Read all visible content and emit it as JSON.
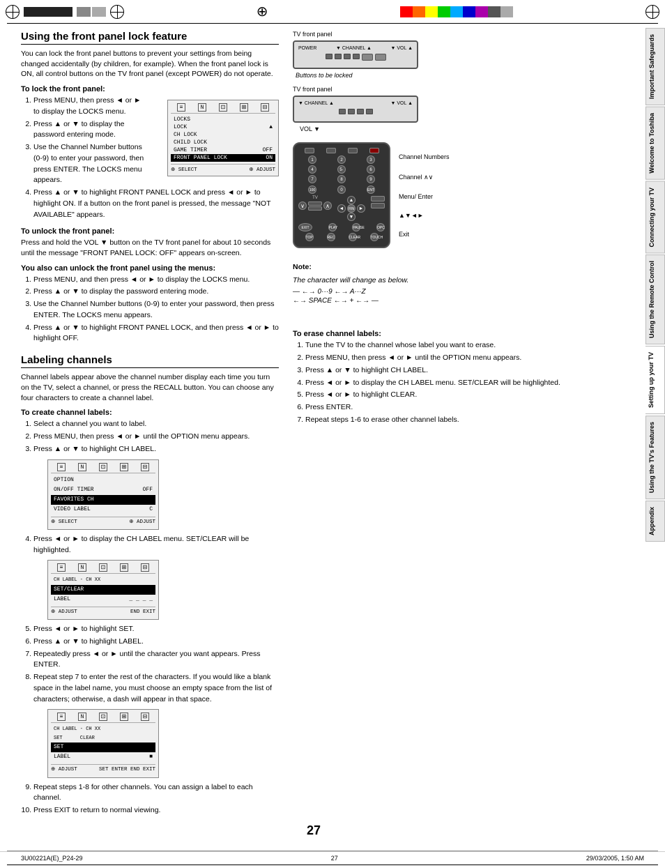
{
  "page": {
    "number": "27",
    "bottom_left": "3U00221A(E)_P24-29",
    "bottom_center": "27",
    "bottom_right": "29/03/2005, 1:50 AM"
  },
  "tabs": [
    {
      "id": "important-safeguards",
      "label": "Important Safeguards",
      "active": false
    },
    {
      "id": "welcome-toshiba",
      "label": "Welcome to Toshiba",
      "active": false
    },
    {
      "id": "connecting-tv",
      "label": "Connecting your TV",
      "active": false
    },
    {
      "id": "remote-control",
      "label": "Using the Remote Control",
      "active": false
    },
    {
      "id": "setting-up",
      "label": "Setting up your TV",
      "active": true
    },
    {
      "id": "tv-features",
      "label": "Using the TV's Features",
      "active": false
    },
    {
      "id": "appendix",
      "label": "Appendix",
      "active": false
    }
  ],
  "section1": {
    "title": "Using the front panel lock feature",
    "intro": "You can lock the front panel buttons to prevent your settings from being changed accidentally (by children, for example). When the front panel lock is ON, all control buttons on the TV front panel (except POWER) do not operate.",
    "lock_heading": "To lock the front panel:",
    "lock_steps": [
      "Press MENU, then press ◄ or ► to display the LOCKS menu.",
      "Press ▲ or ▼ to display the password entering mode.",
      "Use the Channel Number buttons (0-9) to enter your password, then press ENTER. The LOCKS menu appears.",
      "Press ▲ or ▼ to highlight FRONT PANEL LOCK and press ◄ or ► to highlight ON. If a button on the front panel is pressed, the message \"NOT AVAILABLE\" appears."
    ],
    "unlock_heading": "To unlock the front panel:",
    "unlock_text": "Press and hold the VOL ▼ button on the TV front panel for about 10 seconds until the message \"FRONT PANEL LOCK: OFF\" appears on-screen.",
    "menus_heading": "You also can unlock the front panel using the menus:",
    "menus_steps": [
      "Press MENU, and then press ◄ or ► to display the LOCKS menu.",
      "Press ▲ or ▼ to display the password entering mode.",
      "Use the Channel Number buttons (0-9) to enter your password, then press ENTER. The LOCKS menu appears.",
      "Press ▲ or ▼ to highlight FRONT PANEL LOCK, and then press ◄ or ► to highlight OFF."
    ]
  },
  "locks_menu": {
    "icons": [
      "≡",
      "N",
      "⊡",
      "⊞"
    ],
    "title": "LOCKS",
    "rows": [
      {
        "label": "LOCK",
        "value": ""
      },
      {
        "label": "CH LOCK",
        "value": ""
      },
      {
        "label": "CHILD LOCK",
        "value": ""
      },
      {
        "label": "GAME TIMER",
        "value": "OFF"
      },
      {
        "label": "FRONT PANEL LOCK",
        "value": "ON",
        "highlighted": true
      }
    ],
    "footer_left": "⊕ SELECT",
    "footer_right": "⊕ ADJUST"
  },
  "section2": {
    "title": "Labeling channels",
    "intro": "Channel labels appear above the channel number display each time you turn on the TV, select a channel, or press the RECALL button. You can choose any four characters to create a channel label.",
    "create_heading": "To create channel labels:",
    "create_steps": [
      "Select a channel you want to label.",
      "Press MENU, then press ◄ or ► until the OPTION menu appears.",
      "Press ▲ or ▼ to highlight CH LABEL.",
      "Press ◄ or ► to display the CH LABEL menu. SET/CLEAR will be highlighted.",
      "Press ◄ or ► to highlight SET.",
      "Press ▲ or ▼ to highlight LABEL.",
      "Repeatedly press ◄ or ► until the character you want appears. Press ENTER.",
      "Repeat step 7 to enter the rest of the characters. If you would like a blank space in the label name, you must choose an empty space from the list of characters; otherwise, a dash will appear in that space.",
      "Repeat steps 1-8 for other channels. You can assign a label to each channel.",
      "Press EXIT to return to normal viewing."
    ],
    "option_menu": {
      "icons": [
        "≡",
        "N",
        "⊡",
        "⊞"
      ],
      "title": "OPTION",
      "rows": [
        {
          "label": "ON/OFF TIMER",
          "value": "OFF"
        },
        {
          "label": "FAVORITES CH",
          "value": ""
        },
        {
          "label": "VIDEO LABEL",
          "value": "C"
        }
      ],
      "footer_left": "⊕ SELECT",
      "footer_right": "⊕ ADJUST"
    },
    "ch_label_menu1": {
      "icons": [
        "≡",
        "N",
        "⊡",
        "⊞"
      ],
      "title": "CH LABEL - CH XX",
      "rows": [
        {
          "label": "SET/CLEAR",
          "value": "",
          "highlighted": true
        },
        {
          "label": "LABEL",
          "value": "____"
        }
      ],
      "footer_left": "⊕ ADJUST",
      "footer_right": "END EXIT"
    },
    "ch_label_menu2": {
      "icons": [
        "≡",
        "N",
        "⊡",
        "⊞"
      ],
      "title": "CH LABEL - CH XX",
      "rows": [
        {
          "label": "SET",
          "value": "",
          "highlighted": true
        },
        {
          "label": "LABEL",
          "value": "■"
        }
      ],
      "footer_left": "⊕ ADJUST",
      "footer_right": "SET ENTER END EXIT"
    }
  },
  "tv_panel": {
    "label": "TV front panel",
    "label2": "TV front panel",
    "buttons_to_be_locked": "Buttons to be locked",
    "vol_label": "VOL ▼"
  },
  "remote": {
    "channel_numbers_label": "Channel Numbers",
    "channel_label": "Channel ∧∨",
    "menu_enter_label": "Menu/ Enter",
    "arrows_label": "▲▼◄►",
    "exit_label": "Exit"
  },
  "note": {
    "title": "Note:",
    "text": "The character will change as below."
  },
  "char_sequence": {
    "line1": "— ←→ 0···9 ←→ A···Z",
    "line2": "←→ SPACE ←→ + ←→ —"
  },
  "erase_section": {
    "heading": "To erase channel labels:",
    "steps": [
      "Tune the TV to the channel whose label you want to erase.",
      "Press MENU, then press ◄ or ► until the OPTION menu appears.",
      "Press ▲ or ▼ to highlight CH LABEL.",
      "Press ◄ or ► to display the CH LABEL menu. SET/CLEAR will be highlighted.",
      "Press ◄ or ► to highlight CLEAR.",
      "Press ENTER.",
      "Repeat steps 1-6 to erase other channel labels."
    ]
  },
  "detected_text": {
    "press": "Press"
  }
}
